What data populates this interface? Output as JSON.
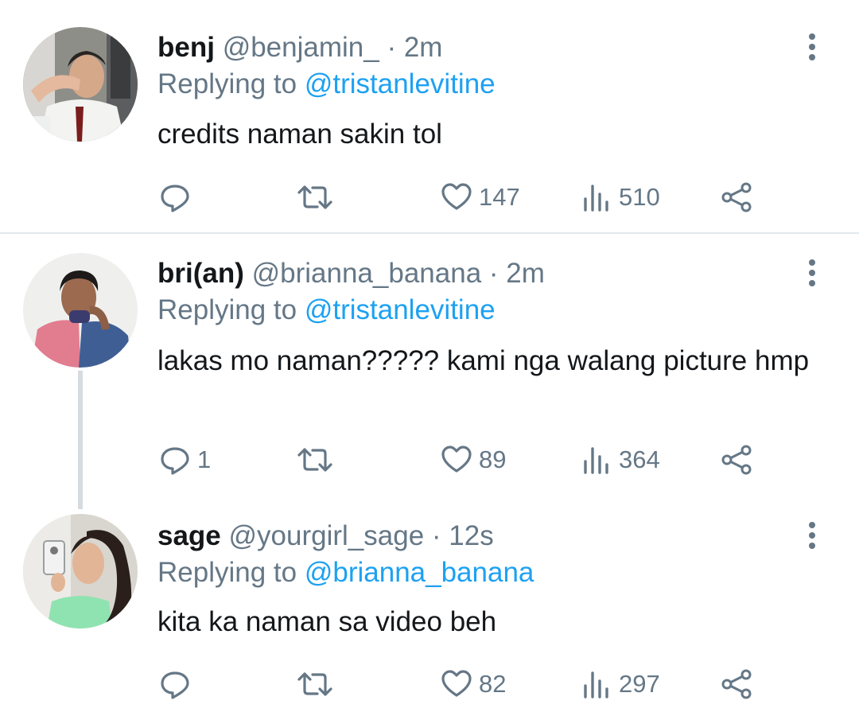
{
  "tweets": [
    {
      "name": "benj",
      "handle": "@benjamin_",
      "separator": "·",
      "time": "2m",
      "replying_prefix": "Replying to",
      "replying_to": "@tristanlevitine",
      "text": "credits naman sakin tol",
      "reply_count": "",
      "like_count": "147",
      "view_count": "510",
      "avatar_icon": "avatar-photo-benj"
    },
    {
      "name": "bri(an)",
      "handle": "@brianna_banana",
      "separator": "·",
      "time": "2m",
      "replying_prefix": "Replying to",
      "replying_to": "@tristanlevitine",
      "text": "lakas mo naman????? kami nga walang picture hmp",
      "reply_count": "1",
      "like_count": "89",
      "view_count": "364",
      "avatar_icon": "avatar-photo-brian"
    },
    {
      "name": "sage",
      "handle": "@yourgirl_sage",
      "separator": "·",
      "time": "12s",
      "replying_prefix": "Replying to",
      "replying_to": "@brianna_banana",
      "text": "kita ka naman sa video beh",
      "reply_count": "",
      "like_count": "82",
      "view_count": "297",
      "avatar_icon": "avatar-photo-sage"
    }
  ],
  "colors": {
    "name": "#14171a",
    "meta": "#657786",
    "mention": "#1da1f2",
    "divider": "#e1e8ed",
    "thread_line": "#d6dbe0"
  },
  "icons": [
    "more-vertical-icon",
    "reply-icon",
    "retweet-icon",
    "like-icon",
    "views-icon",
    "share-icon"
  ]
}
